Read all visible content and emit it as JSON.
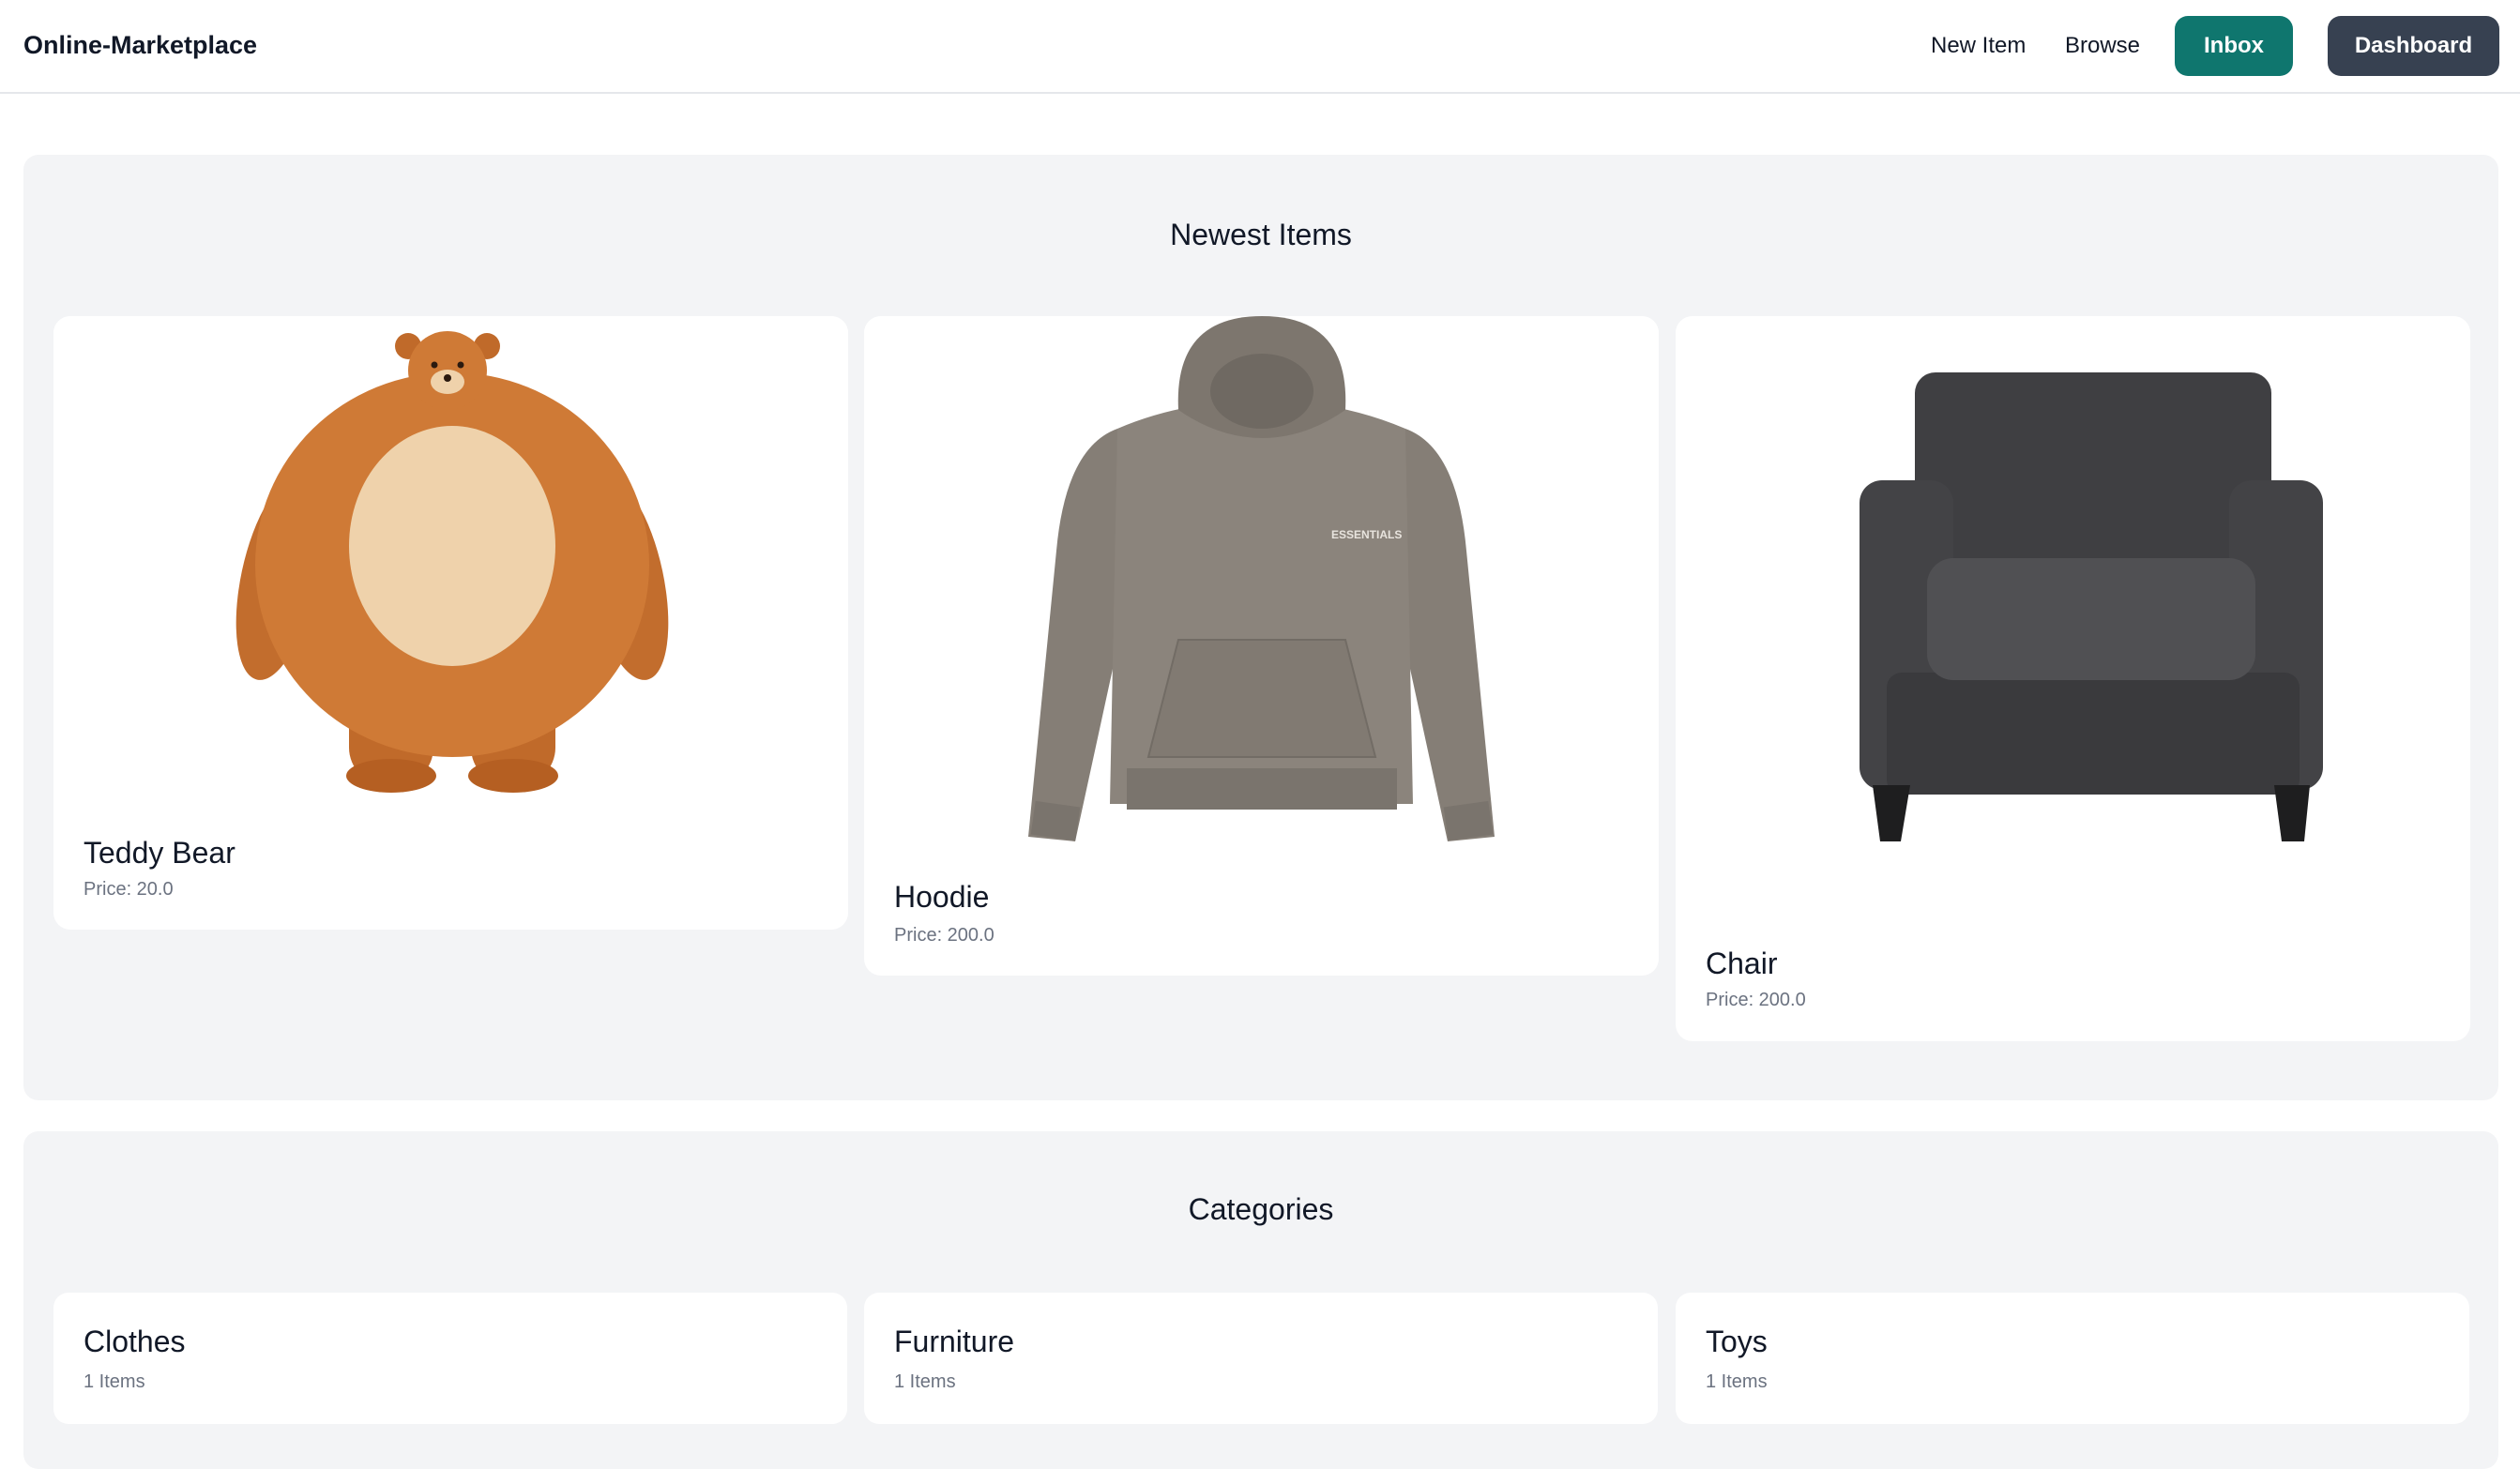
{
  "navbar": {
    "brand": "Online-Marketplace",
    "new_item": "New Item",
    "browse": "Browse",
    "inbox": "Inbox",
    "dashboard": "Dashboard",
    "inbox_color": "#0f766e",
    "dashboard_color": "#374151"
  },
  "newest": {
    "title": "Newest Items",
    "items": [
      {
        "name": "Teddy Bear",
        "price": "Price: 20.0",
        "icon": "teddy-bear-image"
      },
      {
        "name": "Hoodie",
        "price": "Price: 200.0",
        "icon": "hoodie-image"
      },
      {
        "name": "Chair",
        "price": "Price: 200.0",
        "icon": "armchair-image"
      }
    ]
  },
  "categories": {
    "title": "Categories",
    "items": [
      {
        "name": "Clothes",
        "count": "1 Items"
      },
      {
        "name": "Furniture",
        "count": "1 Items"
      },
      {
        "name": "Toys",
        "count": "1 Items"
      }
    ]
  }
}
